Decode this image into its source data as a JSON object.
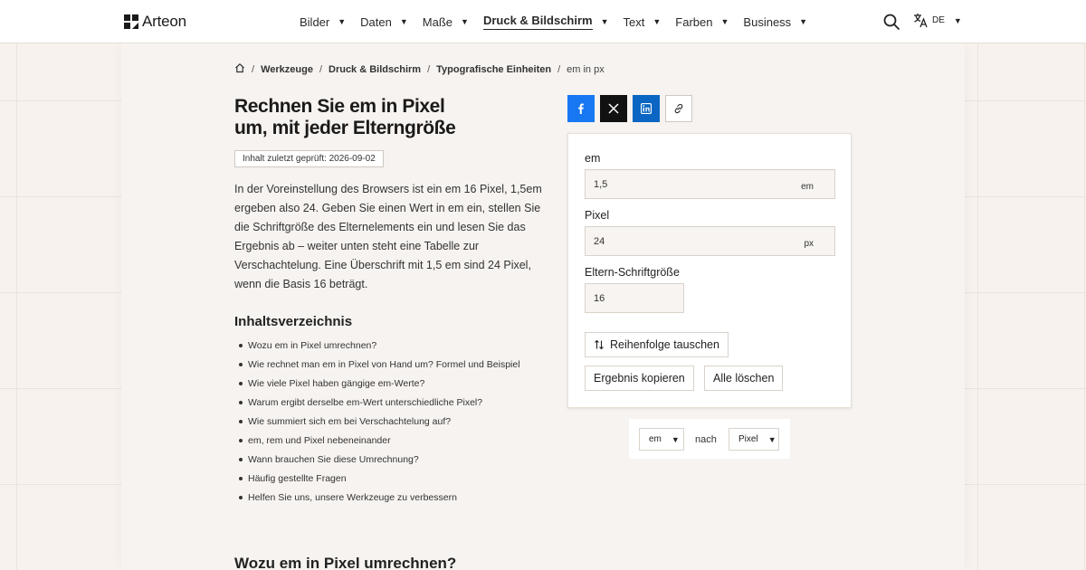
{
  "brand": {
    "name": "Arteon"
  },
  "nav": {
    "items": [
      {
        "label": "Bilder",
        "active": false
      },
      {
        "label": "Daten",
        "active": false
      },
      {
        "label": "Maße",
        "active": false
      },
      {
        "label": "Druck & Bildschirm",
        "active": true
      },
      {
        "label": "Text",
        "active": false
      },
      {
        "label": "Farben",
        "active": false
      },
      {
        "label": "Business",
        "active": false
      }
    ],
    "language": "DE"
  },
  "breadcrumb": {
    "items": [
      "Werkzeuge",
      "Druck & Bildschirm",
      "Typografische Einheiten"
    ],
    "current": "em in px"
  },
  "page": {
    "title_line1": "Rechnen Sie em in Pixel",
    "title_line2": "um, mit jeder Elterngröße",
    "reviewed": "Inhalt zuletzt geprüft: 2026-09-02",
    "intro": "In der Voreinstellung des Browsers ist ein em 16 Pixel, 1,5em ergeben also 24. Geben Sie einen Wert in em ein, stellen Sie die Schriftgröße des Elternelements ein und lesen Sie das Ergebnis ab – weiter unten steht eine Tabelle zur Verschachtelung. Eine Überschrift mit 1,5 em sind 24 Pixel, wenn die Basis 16 beträgt."
  },
  "toc": {
    "title": "Inhaltsverzeichnis",
    "items": [
      "Wozu em in Pixel umrechnen?",
      "Wie rechnet man em in Pixel von Hand um? Formel und Beispiel",
      "Wie viele Pixel haben gängige em-Werte?",
      "Warum ergibt derselbe em-Wert unterschiedliche Pixel?",
      "Wie summiert sich em bei Verschachtelung auf?",
      "em, rem und Pixel nebeneinander",
      "Wann brauchen Sie diese Umrechnung?",
      "Häufig gestellte Fragen",
      "Helfen Sie uns, unsere Werkzeuge zu verbessern"
    ]
  },
  "section": {
    "title": "Wozu em in Pixel umrechnen?"
  },
  "converter": {
    "em_label": "em",
    "em_value": "1,5",
    "em_unit": "em",
    "px_label": "Pixel",
    "px_value": "24",
    "px_unit": "px",
    "parent_label": "Eltern-Schriftgröße",
    "parent_value": "16",
    "swap_label": "Reihenfolge tauschen",
    "copy_label": "Ergebnis kopieren",
    "clear_label": "Alle löschen"
  },
  "direction": {
    "from": "em",
    "connector": "nach",
    "to": "Pixel"
  },
  "colors": {
    "facebook": "#1877f2",
    "x": "#111111",
    "linkedin": "#0a66c2",
    "background": "#f7f2ee"
  },
  "icons": {
    "logo": "arteon-logo-icon",
    "home": "home-icon",
    "search": "search-icon",
    "language": "translate-icon",
    "swap": "swap-vertical-icon",
    "share_link": "link-icon"
  }
}
